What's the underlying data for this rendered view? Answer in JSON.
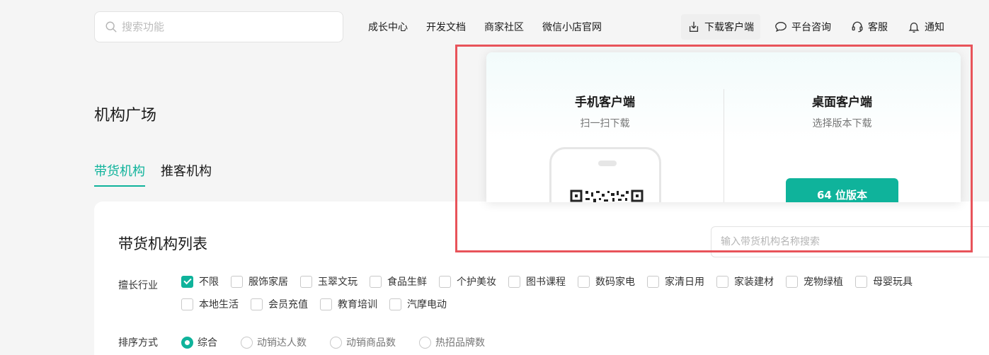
{
  "header": {
    "search_placeholder": "搜索功能",
    "nav": [
      "成长中心",
      "开发文档",
      "商家社区",
      "微信小店官网"
    ],
    "download_label": "下载客户端",
    "consult_label": "平台咨询",
    "service_label": "客服",
    "notice_label": "通知"
  },
  "page": {
    "title": "机构广场",
    "tabs": [
      {
        "label": "带货机构",
        "active": true
      },
      {
        "label": "推客机构",
        "active": false
      }
    ]
  },
  "list": {
    "title": "带货机构列表",
    "search_placeholder": "输入带货机构名称搜索",
    "industry_label": "擅长行业",
    "industries": [
      {
        "label": "不限",
        "checked": true
      },
      {
        "label": "服饰家居",
        "checked": false
      },
      {
        "label": "玉翠文玩",
        "checked": false
      },
      {
        "label": "食品生鲜",
        "checked": false
      },
      {
        "label": "个护美妆",
        "checked": false
      },
      {
        "label": "图书课程",
        "checked": false
      },
      {
        "label": "数码家电",
        "checked": false
      },
      {
        "label": "家清日用",
        "checked": false
      },
      {
        "label": "家装建材",
        "checked": false
      },
      {
        "label": "宠物绿植",
        "checked": false
      },
      {
        "label": "母婴玩具",
        "checked": false
      },
      {
        "label": "本地生活",
        "checked": false
      },
      {
        "label": "会员充值",
        "checked": false
      },
      {
        "label": "教育培训",
        "checked": false
      },
      {
        "label": "汽摩电动",
        "checked": false
      }
    ],
    "sort_label": "排序方式",
    "sort_options": [
      {
        "label": "综合",
        "checked": true
      },
      {
        "label": "动销达人数",
        "checked": false
      },
      {
        "label": "动销商品数",
        "checked": false
      },
      {
        "label": "热招品牌数",
        "checked": false
      }
    ]
  },
  "download_popup": {
    "mobile_title": "手机客户端",
    "mobile_sub": "扫一扫下载",
    "desktop_title": "桌面客户端",
    "desktop_sub": "选择版本下载",
    "btn_64": "64 位版本"
  },
  "colors": {
    "accent": "#0fb39b",
    "highlight": "#e8535a",
    "background": "#f5f5f5"
  }
}
